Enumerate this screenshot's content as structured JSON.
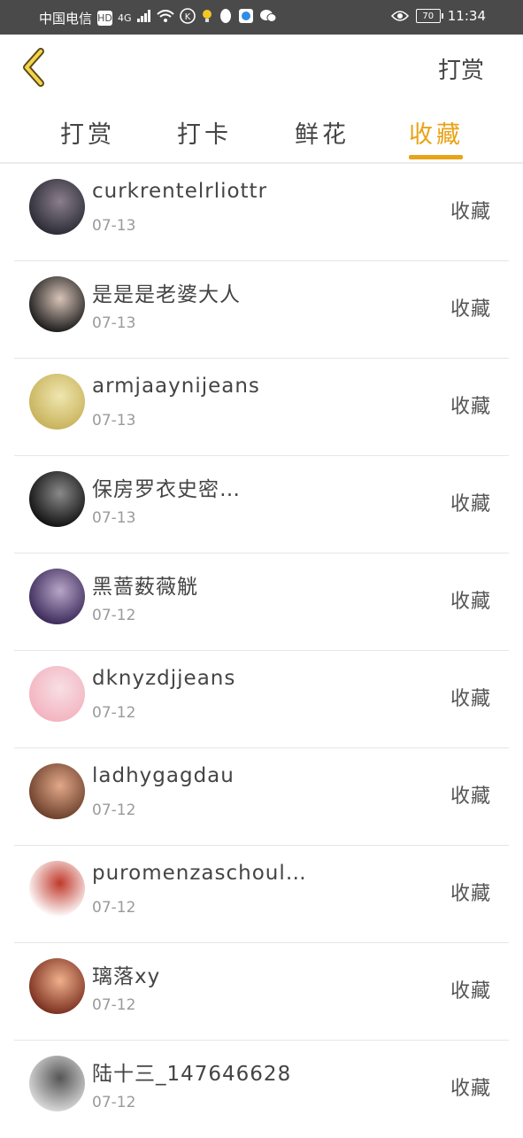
{
  "status_bar": {
    "carrier": "中国电信",
    "hd": "HD",
    "network": "4G",
    "battery": "70",
    "time": "11:34"
  },
  "header": {
    "action_label": "打赏"
  },
  "tabs": [
    {
      "label": "打赏",
      "active": false
    },
    {
      "label": "打卡",
      "active": false
    },
    {
      "label": "鲜花",
      "active": false
    },
    {
      "label": "收藏",
      "active": true
    }
  ],
  "accent_color": "#e8a317",
  "list": [
    {
      "name": "curkrentelrliottr",
      "date": "07-13",
      "action": "收藏",
      "avatar_colors": [
        "#2b2b35",
        "#8a7f8c"
      ]
    },
    {
      "name": "是是是老婆大人",
      "date": "07-13",
      "action": "收藏",
      "avatar_colors": [
        "#1b1b1b",
        "#d8c4b8"
      ]
    },
    {
      "name": "armjaaynijeans",
      "date": "07-13",
      "action": "收藏",
      "avatar_colors": [
        "#c8b25a",
        "#efe6b0"
      ]
    },
    {
      "name": "保房罗衣史密…",
      "date": "07-13",
      "action": "收藏",
      "avatar_colors": [
        "#111111",
        "#8a8a8a"
      ]
    },
    {
      "name": "黑蔷薮薇觥",
      "date": "07-12",
      "action": "收藏",
      "avatar_colors": [
        "#3b2a5a",
        "#b8a6c8"
      ]
    },
    {
      "name": "dknyzdjjeans",
      "date": "07-12",
      "action": "收藏",
      "avatar_colors": [
        "#f3b3c0",
        "#f7dfe3"
      ]
    },
    {
      "name": "ladhygagdau",
      "date": "07-12",
      "action": "收藏",
      "avatar_colors": [
        "#6b3f2a",
        "#e2a88a"
      ]
    },
    {
      "name": "puromenzaschoul…",
      "date": "07-12",
      "action": "收藏",
      "avatar_colors": [
        "#ffffff",
        "#c0392b"
      ]
    },
    {
      "name": "璃落xy",
      "date": "07-12",
      "action": "收藏",
      "avatar_colors": [
        "#7a2f1f",
        "#f0b08c"
      ]
    },
    {
      "name": "陆十三_147646628",
      "date": "07-12",
      "action": "收藏",
      "avatar_colors": [
        "#d9d9d9",
        "#555555"
      ]
    }
  ]
}
